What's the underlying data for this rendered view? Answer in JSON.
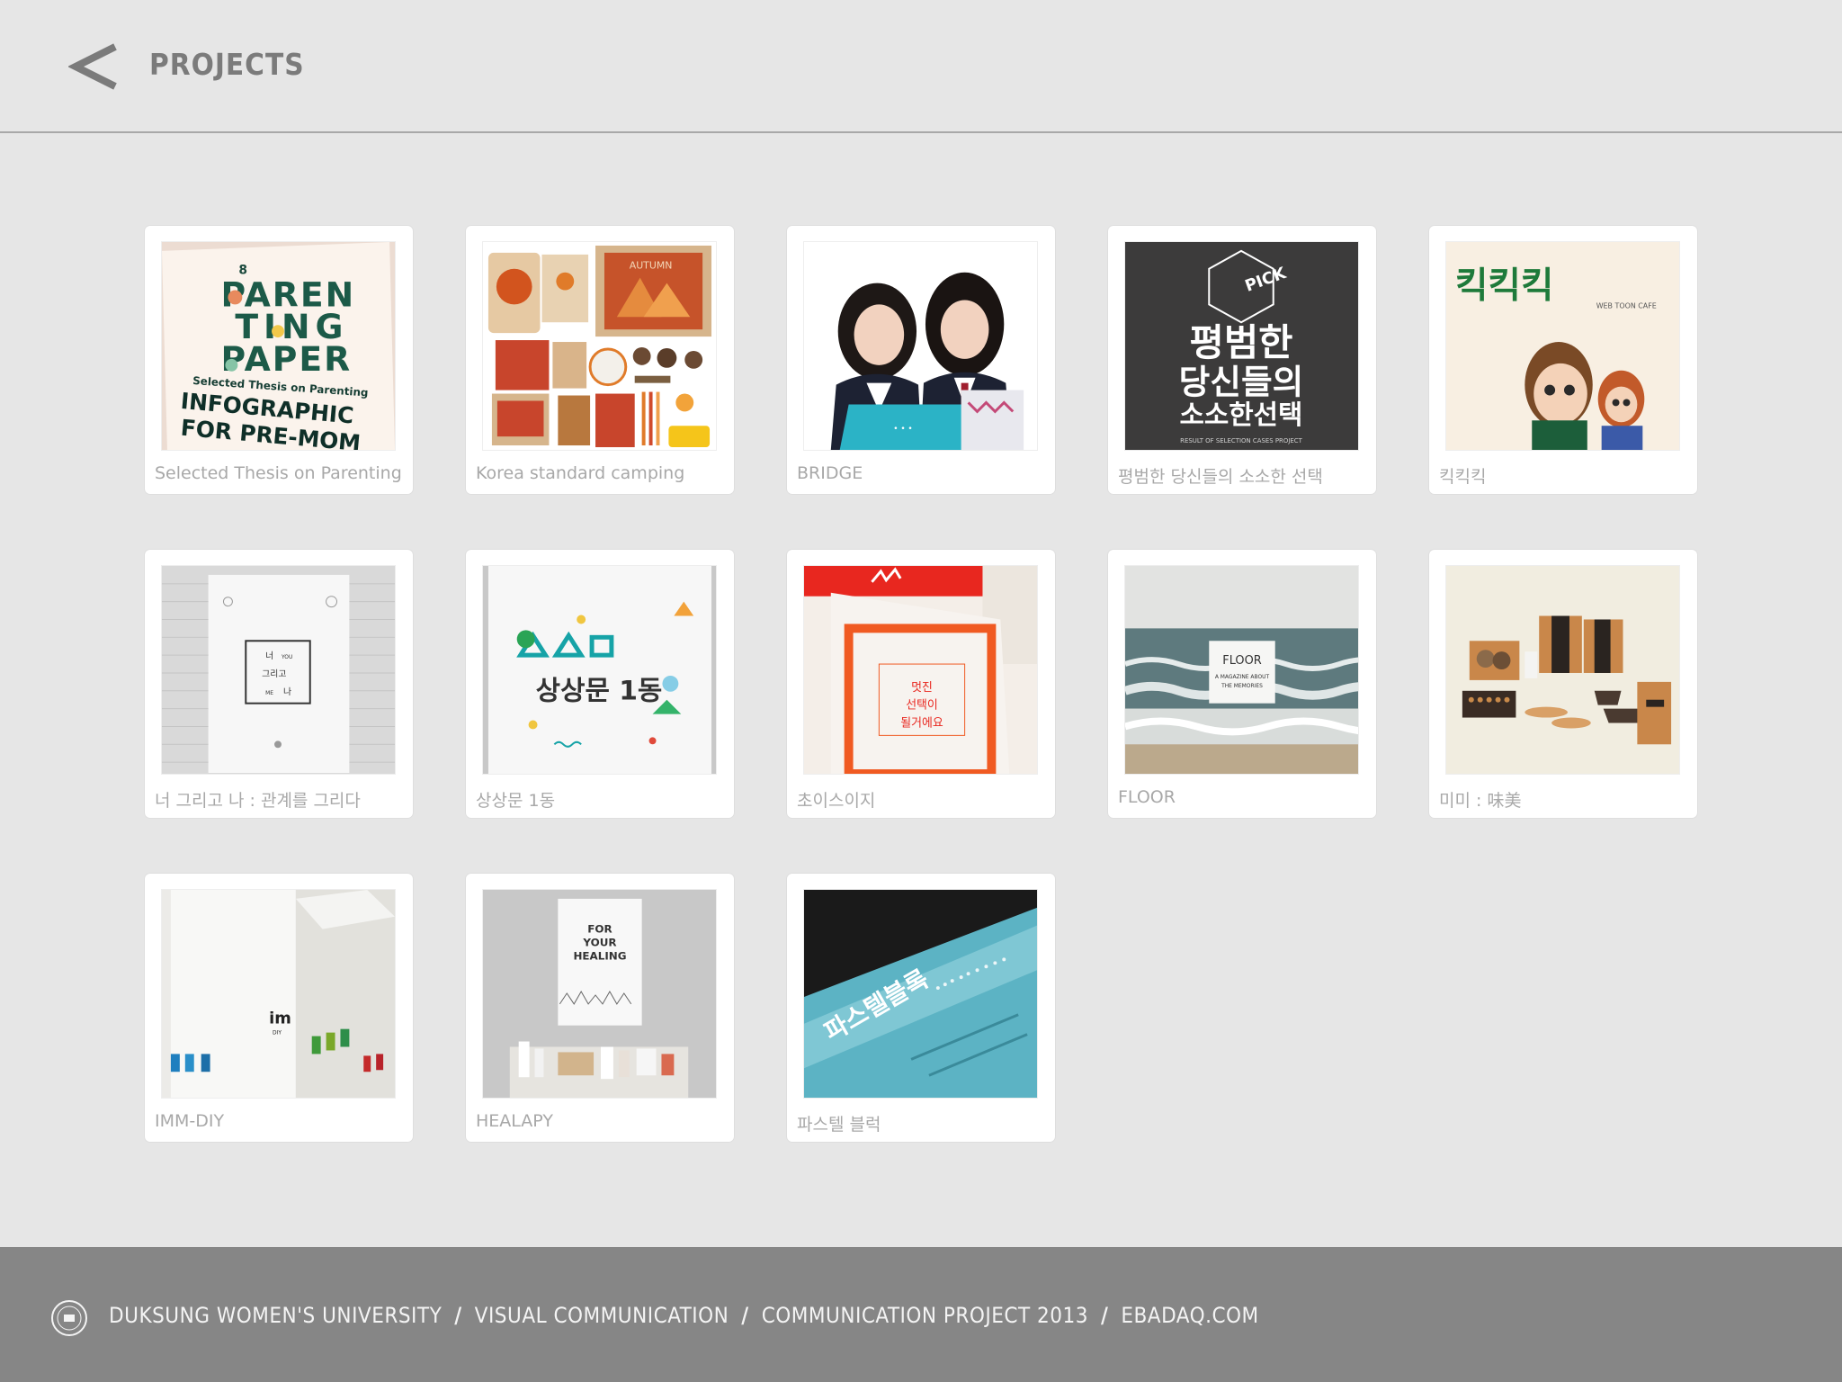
{
  "header": {
    "title": "PROJECTS"
  },
  "projects": [
    {
      "caption": "Selected Thesis on Parenting",
      "thumb_text": [
        "8",
        "PAREN",
        "TING",
        "PAPER",
        "Selected Thesis on Parenting",
        "INFOGRAPHIC",
        "FOR PRE-MOM"
      ]
    },
    {
      "caption": "Korea standard camping",
      "thumb_text": [
        "AUTUMN"
      ]
    },
    {
      "caption": "BRIDGE",
      "thumb_text": []
    },
    {
      "caption": "평범한 당신들의 소소한 선택",
      "thumb_text": [
        "PICK",
        "평범한",
        "당신들의",
        "소소한선택",
        "RESULT OF SELECTION CASES PROJECT"
      ]
    },
    {
      "caption": "킥킥킥",
      "thumb_text": [
        "킥킥킥",
        "WEB TOON CAFE"
      ]
    },
    {
      "caption": "너 그리고 나 : 관계를 그리다",
      "thumb_text": [
        "너",
        "YOU",
        "그리고",
        "ME",
        "나"
      ]
    },
    {
      "caption": "상상문 1동",
      "thumb_text": [
        "상상문 1동"
      ]
    },
    {
      "caption": "초이스이지",
      "thumb_text": [
        "멋진",
        "선택이",
        "될거에요"
      ]
    },
    {
      "caption": "FLOOR",
      "thumb_text": [
        "FLOOR",
        "A MAGAZINE ABOUT",
        "THE MEMORIES"
      ]
    },
    {
      "caption": "미미 : 味美",
      "thumb_text": []
    },
    {
      "caption": "IMM-DIY",
      "thumb_text": [
        "im",
        "DIY"
      ]
    },
    {
      "caption": "HEALAPY",
      "thumb_text": [
        "FOR",
        "YOUR",
        "HEALING"
      ]
    },
    {
      "caption": "파스텔 블럭",
      "thumb_text": [
        "파스텔블록"
      ]
    }
  ],
  "footer": {
    "parts": [
      "DUKSUNG WOMEN'S UNIVERSITY",
      "VISUAL COMMUNICATION",
      "COMMUNICATION PROJECT 2013",
      "EBADAQ.COM"
    ],
    "separator": "/"
  },
  "colors": {
    "background": "#e6e6e6",
    "footer": "#868686",
    "caption": "#a8a8a8",
    "title": "#7b7b7b"
  },
  "icons": {
    "back": "chevron-left-icon",
    "footer_logo": "university-seal-icon"
  }
}
